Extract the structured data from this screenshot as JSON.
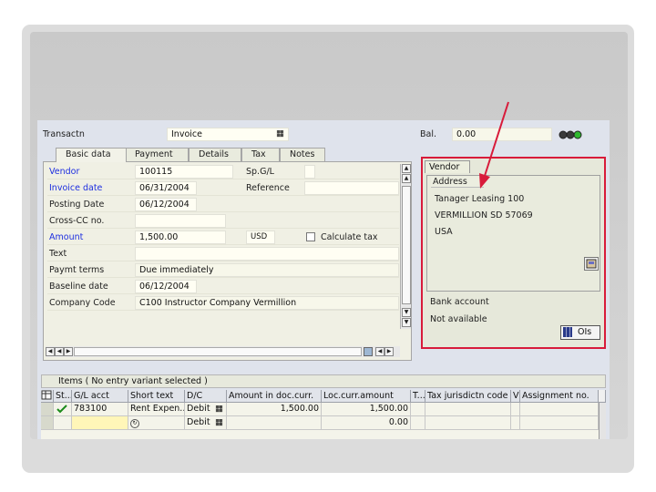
{
  "header": {
    "transaction_label": "Transactn",
    "transaction_value": "Invoice",
    "balance_label": "Bal.",
    "balance_value": "0.00",
    "status_light_colors": [
      "#3a3a3a",
      "#3a3a3a",
      "#2fb82f"
    ]
  },
  "tabs": [
    {
      "label": "Basic data",
      "active": true
    },
    {
      "label": "Payment",
      "active": false
    },
    {
      "label": "Details",
      "active": false
    },
    {
      "label": "Tax",
      "active": false
    },
    {
      "label": "Notes",
      "active": false
    }
  ],
  "basic_data": {
    "vendor_label": "Vendor",
    "vendor_value": "100115",
    "spgl_label": "Sp.G/L",
    "invoice_date_label": "Invoice date",
    "invoice_date_value": "06/31/2004",
    "reference_label": "Reference",
    "posting_date_label": "Posting Date",
    "posting_date_value": "06/12/2004",
    "crosscc_label": "Cross-CC no.",
    "amount_label": "Amount",
    "amount_value": "1,500.00",
    "currency_value": "USD",
    "calculate_tax_label": "Calculate tax",
    "text_label": "Text",
    "payment_terms_label": "Paymt terms",
    "payment_terms_value": "Due immediately",
    "baseline_date_label": "Baseline date",
    "baseline_date_value": "06/12/2004",
    "company_code_label": "Company Code",
    "company_code_value": "C100 Instructor Company Vermillion"
  },
  "vendor_panel": {
    "tab_label": "Vendor",
    "address_label": "Address",
    "address_lines": [
      "Tanager Leasing 100",
      "VERMILLION SD  57069",
      "USA"
    ],
    "bank_account_label": "Bank account",
    "bank_account_value": "Not available",
    "ois_button": "OIs"
  },
  "items": {
    "title": "Items ( No entry variant selected )",
    "columns": [
      "St...",
      "G/L acct",
      "Short text",
      "D/C",
      "Amount in doc.curr.",
      "Loc.curr.amount",
      "T...",
      "Tax jurisdictn code",
      "V",
      "Assignment no."
    ],
    "rows": [
      {
        "gl": "783100",
        "short": "Rent Expen...",
        "dc": "Debit",
        "amount": "1,500.00",
        "local": "1,500.00"
      },
      {
        "gl": "",
        "short": "",
        "dc": "Debit",
        "amount": "",
        "local": "0.00"
      }
    ]
  },
  "annotation": {
    "arrow_color": "#d81b3a",
    "box_color": "#d81b3a"
  }
}
